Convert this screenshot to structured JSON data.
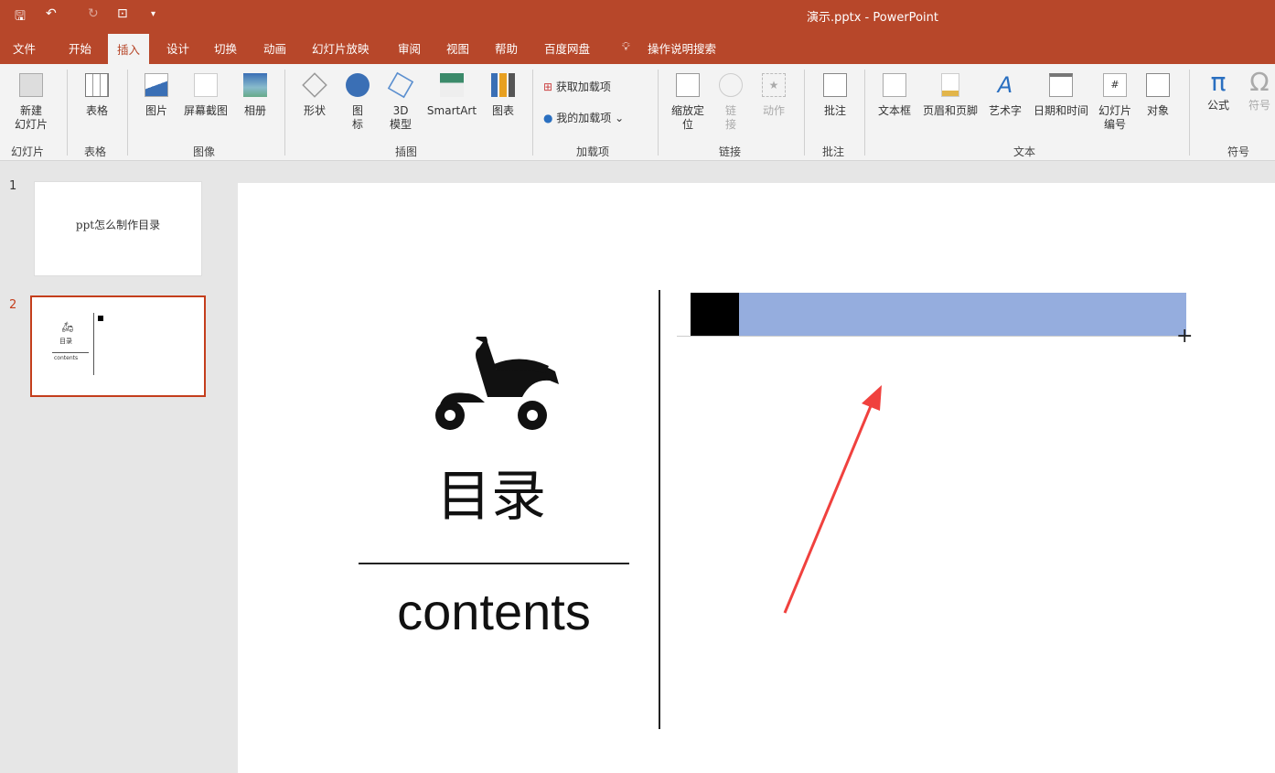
{
  "window": {
    "title": "演示.pptx - PowerPoint"
  },
  "quick_access": [
    {
      "icon": "save-icon",
      "glyph": "🖫"
    },
    {
      "icon": "undo-icon",
      "glyph": "↶"
    },
    {
      "icon": "redo-icon",
      "glyph": "↻"
    },
    {
      "icon": "present-icon",
      "glyph": "⊡"
    },
    {
      "icon": "customize-icon",
      "glyph": "▾"
    }
  ],
  "tabs": [
    "文件",
    "开始",
    "插入",
    "设计",
    "切换",
    "动画",
    "幻灯片放映",
    "审阅",
    "视图",
    "帮助",
    "百度网盘"
  ],
  "active_tab": "插入",
  "tell_me": "操作说明搜索",
  "ribbon": {
    "buttons": [
      "新建\n幻灯片",
      "表格",
      "图片",
      "屏幕截图",
      "相册",
      "形状",
      "图\n标",
      "3D\n模型",
      "SmartArt",
      "图表",
      "获取加载项",
      "我的加载项",
      "缩放定\n位",
      "链\n接",
      "动作",
      "批注",
      "文本框",
      "页眉和页脚",
      "艺术字",
      "日期和时间",
      "幻灯片\n编号",
      "对象",
      "公式",
      "符号"
    ],
    "groups": [
      "幻灯片",
      "表格",
      "图像",
      "插图",
      "加载项",
      "链接",
      "批注",
      "文本",
      "符号"
    ]
  },
  "slides": [
    {
      "number": "1",
      "title": "ppt怎么制作目录"
    },
    {
      "number": "2",
      "title": "目录",
      "subtitle": "contents"
    }
  ],
  "selected_slide": "2",
  "slide": {
    "heading": "目录",
    "subheading": "contents",
    "icon": "scooter-icon",
    "bar_color": "#8fa9dc",
    "accent": "#000000",
    "arrow_color": "#f0413e"
  },
  "colors": {
    "brand": "#b7472a"
  }
}
